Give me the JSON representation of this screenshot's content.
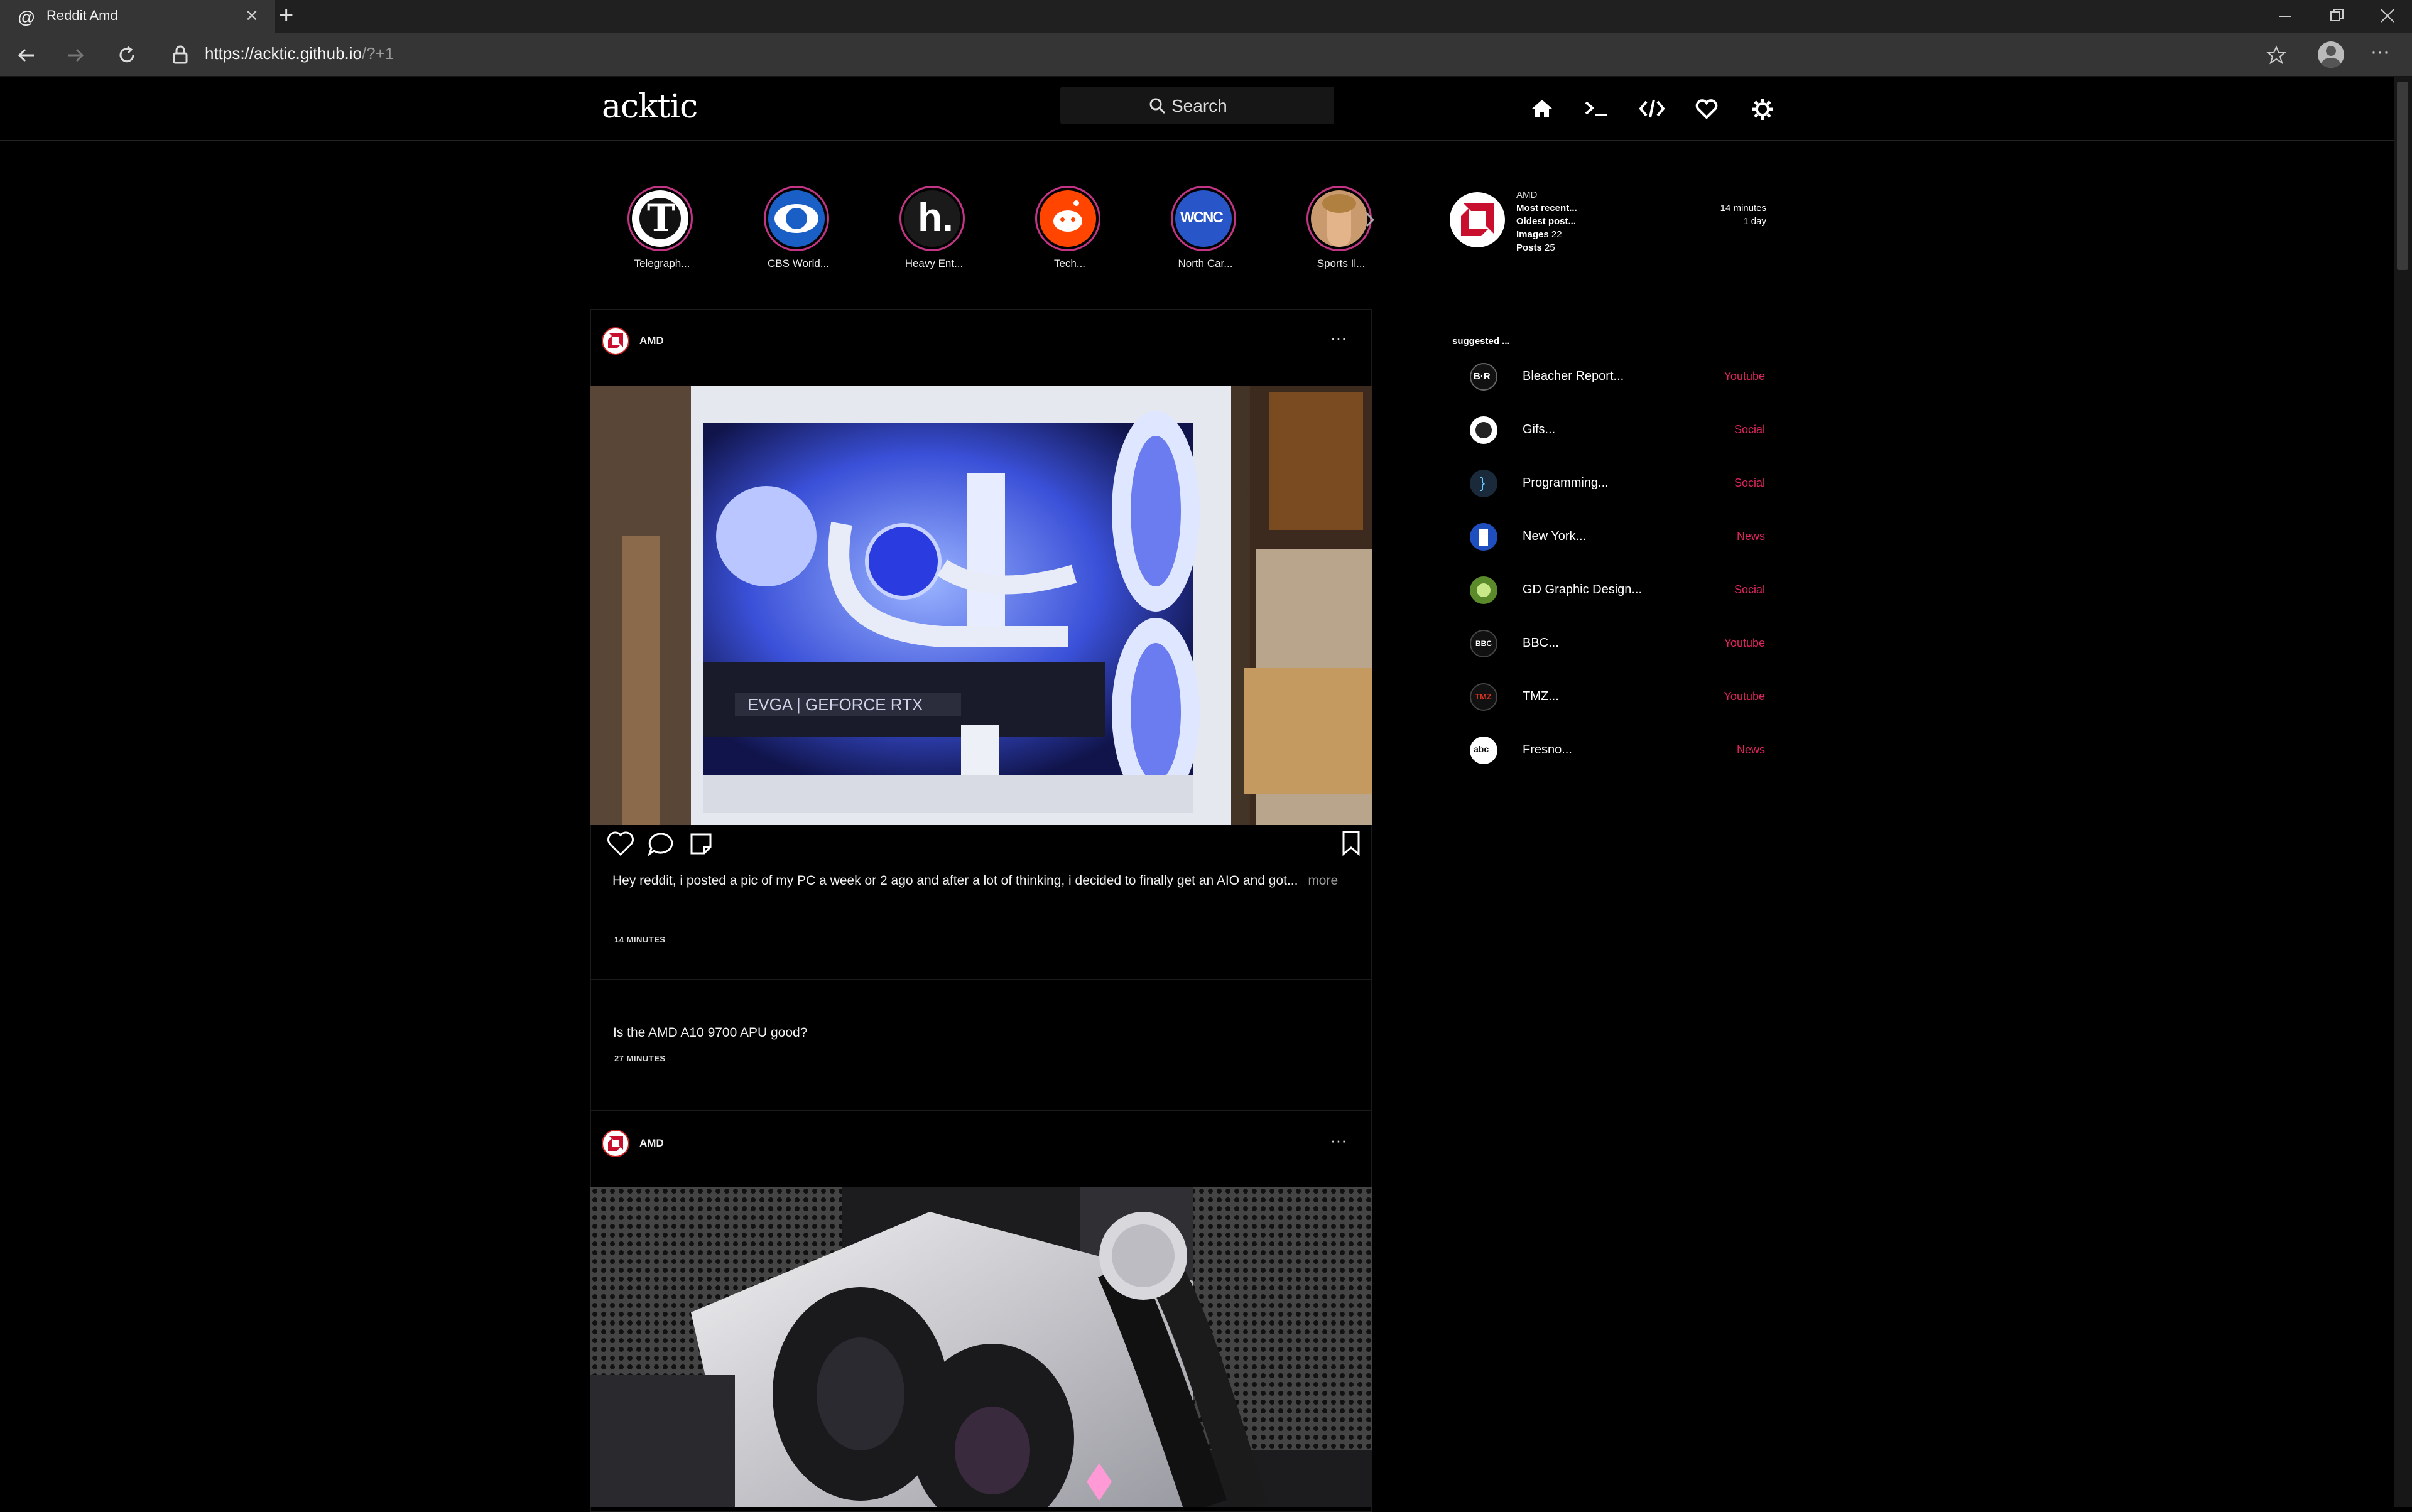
{
  "browser": {
    "tab_title": "Reddit Amd",
    "new_tab": "+",
    "url_main": "https://acktic.github.io",
    "url_rest": "/?+1",
    "window_controls": [
      "minimize-icon",
      "restore-icon",
      "close-icon"
    ],
    "menu": "···"
  },
  "site": {
    "logo": "acktic",
    "search_label": "Search",
    "nav_icons": [
      "home-icon",
      "terminal-icon",
      "code-icon",
      "heart-icon",
      "settings-icon"
    ]
  },
  "stories": [
    {
      "label": "Telegraph..."
    },
    {
      "label": "CBS World..."
    },
    {
      "label": "Heavy Ent..."
    },
    {
      "label": "Tech..."
    },
    {
      "label": "North Car..."
    },
    {
      "label": "Sports Il..."
    }
  ],
  "profile": {
    "name": "AMD",
    "most_recent_label": "Most recent...",
    "most_recent_value": "14 minutes",
    "oldest_label": "Oldest post...",
    "oldest_value": "1 day",
    "images_label": "Images",
    "images_value": "22",
    "posts_label": "Posts",
    "posts_value": "25"
  },
  "suggested": {
    "title": "suggested ...",
    "items": [
      {
        "name": "Bleacher Report...",
        "type": "Youtube",
        "icon_text": "B·R"
      },
      {
        "name": "Gifs...",
        "type": "Social",
        "icon_text": ""
      },
      {
        "name": "Programming...",
        "type": "Social",
        "icon_text": "}"
      },
      {
        "name": "New York...",
        "type": "News",
        "icon_text": ""
      },
      {
        "name": "GD Graphic Design...",
        "type": "Social",
        "icon_text": ""
      },
      {
        "name": "BBC...",
        "type": "Youtube",
        "icon_text": "BBC"
      },
      {
        "name": "TMZ...",
        "type": "Youtube",
        "icon_text": "TMZ"
      },
      {
        "name": "Fresno...",
        "type": "News",
        "icon_text": "abc"
      }
    ]
  },
  "posts": [
    {
      "author": "AMD",
      "more_menu": "···",
      "caption": "Hey reddit, i posted a pic of my PC a week or 2 ago and after a lot of thinking, i decided to finally get an AIO and got...",
      "more_link": "more",
      "time": "14 MINUTES",
      "image_text": "EVGA | GEFORCE RTX"
    },
    {
      "title": "Is the AMD A10 9700 APU good?",
      "time": "27 MINUTES"
    },
    {
      "author": "AMD",
      "more_menu": "···"
    }
  ]
}
